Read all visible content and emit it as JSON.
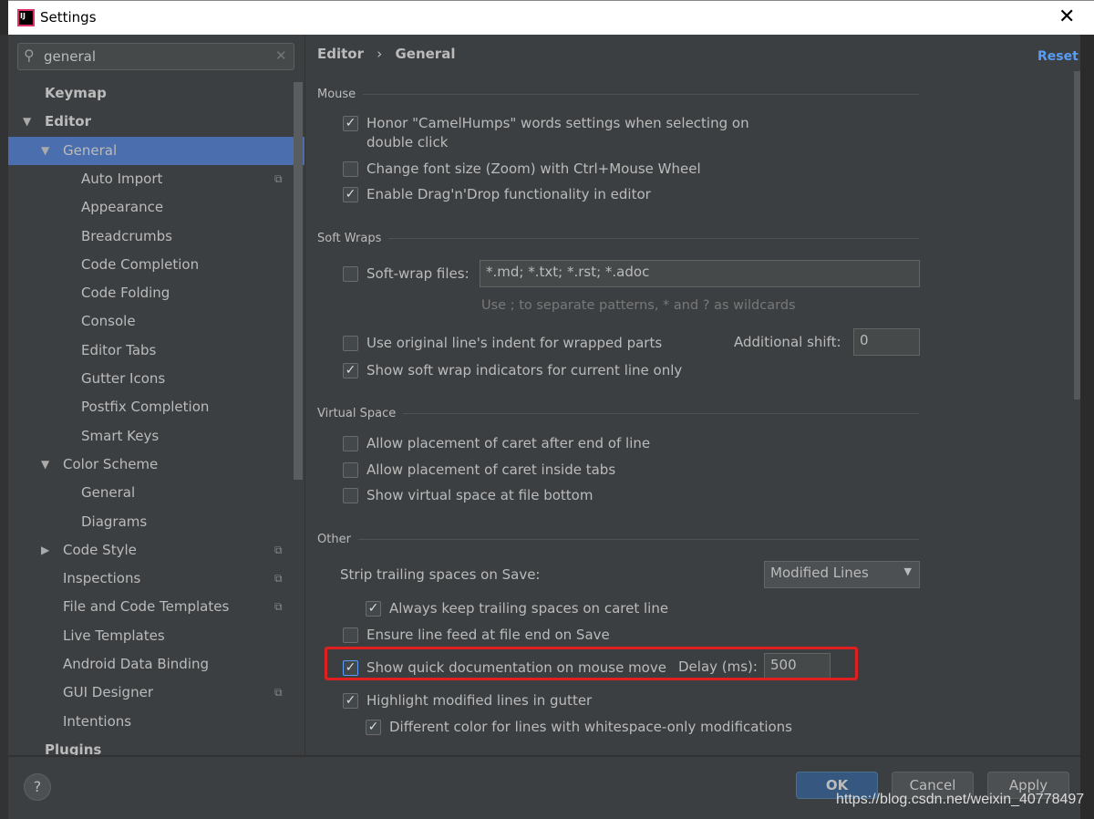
{
  "window": {
    "title": "Settings",
    "close": "✕",
    "logo": "IJ"
  },
  "search": {
    "value": "general",
    "icon": "search-icon",
    "clear": "✕"
  },
  "tree": [
    {
      "label": "Keymap",
      "level": 0,
      "bold": true
    },
    {
      "label": "Editor",
      "level": 0,
      "bold": true,
      "expanded": true
    },
    {
      "label": "General",
      "level": 1,
      "expanded": true,
      "selected": true
    },
    {
      "label": "Auto Import",
      "level": 2,
      "copy": true
    },
    {
      "label": "Appearance",
      "level": 2
    },
    {
      "label": "Breadcrumbs",
      "level": 2
    },
    {
      "label": "Code Completion",
      "level": 2
    },
    {
      "label": "Code Folding",
      "level": 2
    },
    {
      "label": "Console",
      "level": 2
    },
    {
      "label": "Editor Tabs",
      "level": 2
    },
    {
      "label": "Gutter Icons",
      "level": 2
    },
    {
      "label": "Postfix Completion",
      "level": 2
    },
    {
      "label": "Smart Keys",
      "level": 2
    },
    {
      "label": "Color Scheme",
      "level": 1,
      "expanded": true
    },
    {
      "label": "General",
      "level": 2
    },
    {
      "label": "Diagrams",
      "level": 2
    },
    {
      "label": "Code Style",
      "level": 1,
      "collapsed": true,
      "copy": true
    },
    {
      "label": "Inspections",
      "level": 1,
      "copy": true
    },
    {
      "label": "File and Code Templates",
      "level": 1,
      "copy": true
    },
    {
      "label": "Live Templates",
      "level": 1
    },
    {
      "label": "Android Data Binding",
      "level": 1
    },
    {
      "label": "GUI Designer",
      "level": 1,
      "copy": true
    },
    {
      "label": "Intentions",
      "level": 1
    },
    {
      "label": "Plugins",
      "level": 0,
      "bold": true
    }
  ],
  "breadcrumb": {
    "parent": "Editor",
    "sep": "›",
    "current": "General"
  },
  "reset": "Reset",
  "sections": {
    "mouse": "Mouse",
    "soft_wraps": "Soft Wraps",
    "virtual_space": "Virtual Space",
    "other": "Other"
  },
  "options": {
    "camel": {
      "label": "Honor \"CamelHumps\" words settings when selecting on double click",
      "checked": true
    },
    "zoom": {
      "label": "Change font size (Zoom) with Ctrl+Mouse Wheel",
      "checked": false
    },
    "dnd": {
      "label": "Enable Drag'n'Drop functionality in editor",
      "checked": true
    },
    "softwrap": {
      "label": "Soft-wrap files:",
      "checked": false,
      "value": "*.md; *.txt; *.rst; *.adoc",
      "hint": "Use ; to separate patterns, * and ? as wildcards"
    },
    "indent": {
      "label": "Use original line's indent for wrapped parts",
      "checked": false,
      "shift_label": "Additional shift:",
      "shift_value": "0"
    },
    "indicators": {
      "label": "Show soft wrap indicators for current line only",
      "checked": true
    },
    "caret_end": {
      "label": "Allow placement of caret after end of line",
      "checked": false
    },
    "caret_tabs": {
      "label": "Allow placement of caret inside tabs",
      "checked": false
    },
    "virtual_bottom": {
      "label": "Show virtual space at file bottom",
      "checked": false
    },
    "strip": {
      "label": "Strip trailing spaces on Save:",
      "value": "Modified Lines"
    },
    "keep_trailing": {
      "label": "Always keep trailing spaces on caret line",
      "checked": true
    },
    "line_feed": {
      "label": "Ensure line feed at file end on Save",
      "checked": false
    },
    "quick_doc": {
      "label": "Show quick documentation on mouse move",
      "checked": true,
      "delay_label": "Delay (ms):",
      "delay_value": "500"
    },
    "highlight": {
      "label": "Highlight modified lines in gutter",
      "checked": true
    },
    "whitespace": {
      "label": "Different color for lines with whitespace-only modifications",
      "checked": true
    }
  },
  "footer": {
    "help": "?",
    "ok": "OK",
    "cancel": "Cancel",
    "apply": "Apply"
  },
  "watermark": "https://blog.csdn.net/weixin_40778497",
  "colors": {
    "selection": "#4b6eaf",
    "accent": "#589df6",
    "highlight_box": "#e02020"
  }
}
